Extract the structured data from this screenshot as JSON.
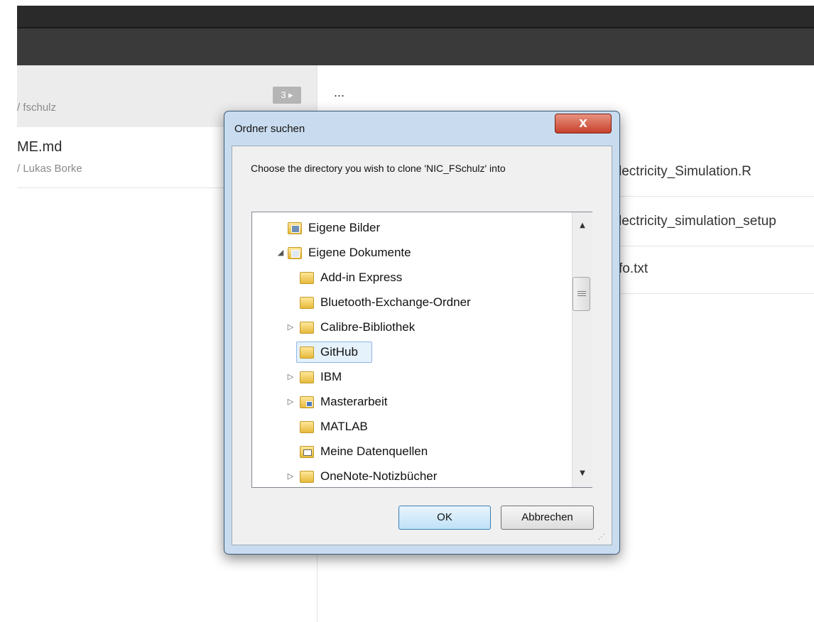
{
  "background": {
    "history": [
      {
        "subtitle": "/ fschulz"
      },
      {
        "title": "ME.md",
        "subtitle": "/ Lukas Borke"
      }
    ],
    "badge": "3 ▸",
    "ellipsis": "...",
    "files": [
      "lectricity_Simulation.R",
      "lectricity_simulation_setup",
      "fo.txt"
    ]
  },
  "dialog": {
    "title": "Ordner suchen",
    "close_label": "X",
    "prompt": "Choose the directory you wish to clone 'NIC_FSchulz' into",
    "tree": [
      {
        "label": "Eigene Bilder",
        "icon": "pictures-folder-icon",
        "expander": ""
      },
      {
        "label": "Eigene Dokumente",
        "icon": "documents-folder-icon",
        "expander": "◢"
      },
      {
        "label": "Add-in Express",
        "icon": "folder-icon",
        "expander": ""
      },
      {
        "label": "Bluetooth-Exchange-Ordner",
        "icon": "folder-icon",
        "expander": ""
      },
      {
        "label": "Calibre-Bibliothek",
        "icon": "folder-icon",
        "expander": "▷"
      },
      {
        "label": "GitHub",
        "icon": "folder-icon",
        "expander": "",
        "selected": true
      },
      {
        "label": "IBM",
        "icon": "folder-icon",
        "expander": "▷"
      },
      {
        "label": "Masterarbeit",
        "icon": "shared-folder-icon",
        "expander": "▷"
      },
      {
        "label": "MATLAB",
        "icon": "folder-icon",
        "expander": ""
      },
      {
        "label": "Meine Datenquellen",
        "icon": "data-sources-folder-icon",
        "expander": ""
      },
      {
        "label": "OneNote-Notizbücher",
        "icon": "folder-icon",
        "expander": "▷"
      }
    ],
    "ok_label": "OK",
    "cancel_label": "Abbrechen",
    "scroll_up": "▲",
    "scroll_down": "▼"
  },
  "colors": {
    "dialog_frame": "#c9dcef",
    "close_red": "#c7402b",
    "selection": "#e5f1fb",
    "folder_yellow": "#e6b93a"
  }
}
